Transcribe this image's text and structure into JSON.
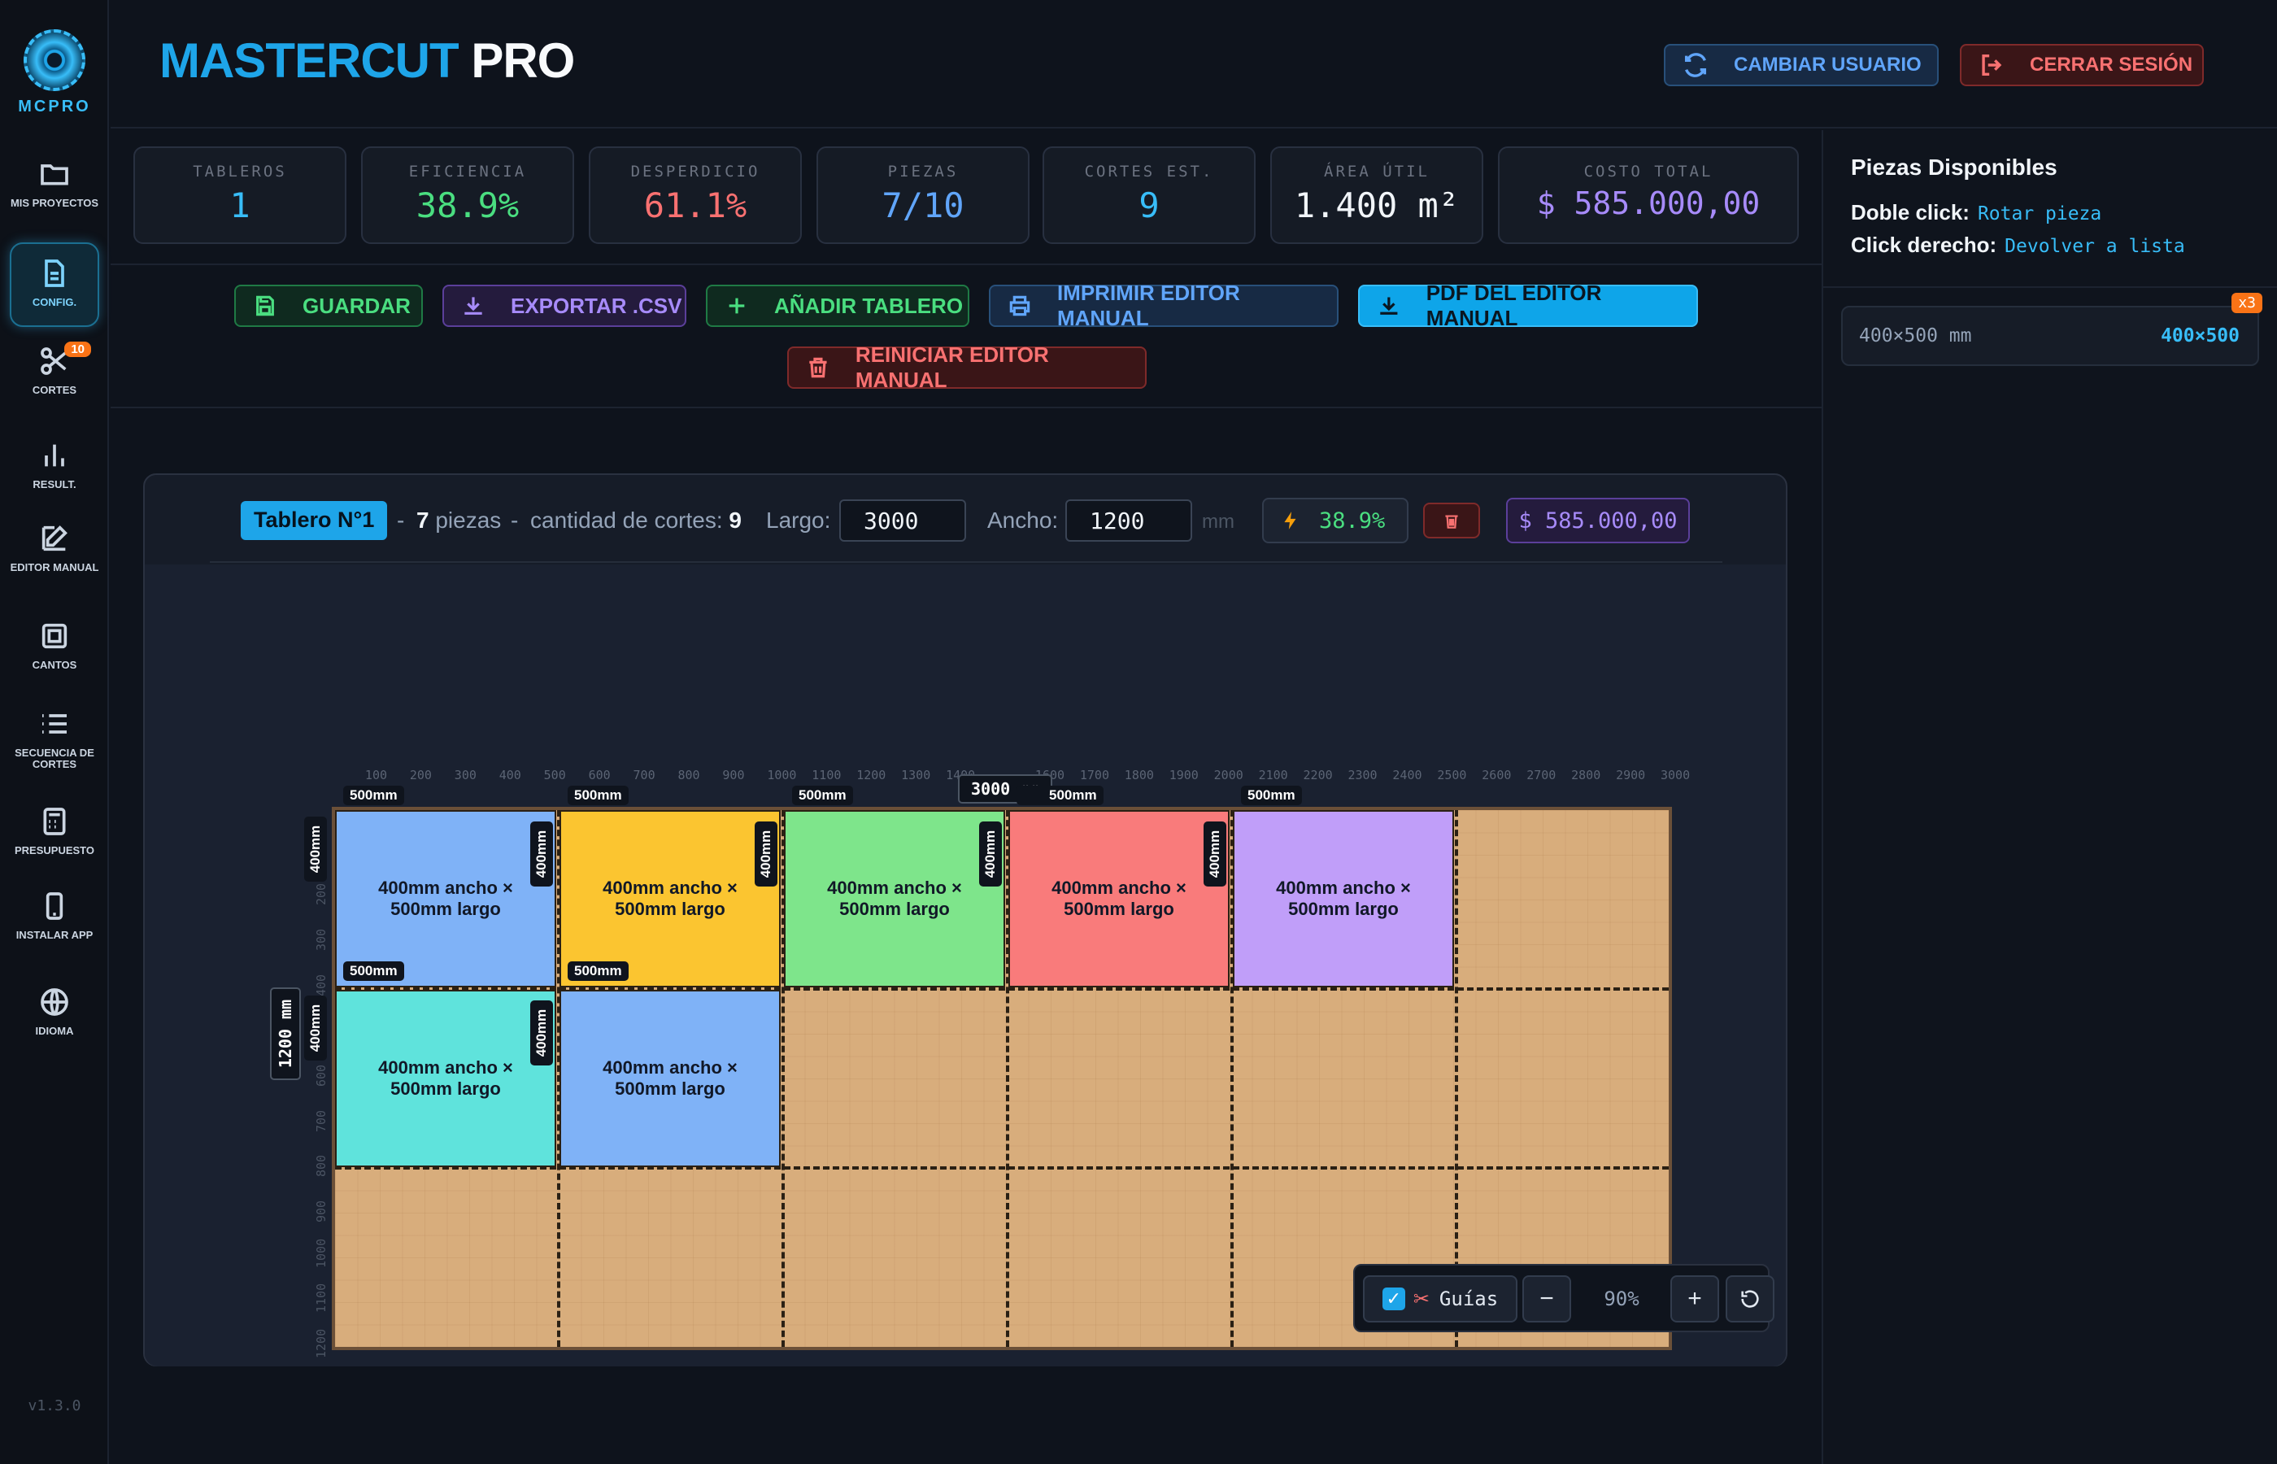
{
  "sidebar": {
    "logo_text": "MCPRO",
    "version": "v1.3.0",
    "items": [
      {
        "label": "MIS PROYECTOS",
        "icon": "folder-icon"
      },
      {
        "label": "CONFIG.",
        "icon": "document-icon"
      },
      {
        "label": "CORTES",
        "icon": "scissors-icon",
        "badge": "10"
      },
      {
        "label": "RESULT.",
        "icon": "bar-chart-icon"
      },
      {
        "label": "EDITOR MANUAL",
        "icon": "edit-icon"
      },
      {
        "label": "CANTOS",
        "icon": "square-icon"
      },
      {
        "label": "SECUENCIA DE CORTES",
        "icon": "list-icon"
      },
      {
        "label": "PRESUPUESTO",
        "icon": "calculator-icon"
      },
      {
        "label": "INSTALAR APP",
        "icon": "phone-icon"
      },
      {
        "label": "IDIOMA",
        "icon": "globe-icon"
      }
    ]
  },
  "header": {
    "brand_a": "MASTERCUT",
    "brand_b": "PRO",
    "switch_user": "CAMBIAR USUARIO",
    "logout": "CERRAR SESIÓN"
  },
  "stats": [
    {
      "title": "TABLEROS",
      "value": "1",
      "color": "#38bdf8"
    },
    {
      "title": "EFICIENCIA",
      "value": "38.9%",
      "color": "#4ade80"
    },
    {
      "title": "DESPERDICIO",
      "value": "61.1%",
      "color": "#f87171"
    },
    {
      "title": "PIEZAS",
      "value": "7/10",
      "color": "#60a5fa"
    },
    {
      "title": "CORTES EST.",
      "value": "9",
      "color": "#38bdf8"
    },
    {
      "title": "ÁREA ÚTIL",
      "value": "1.400 m²",
      "color": "#f1f5f9"
    },
    {
      "title": "COSTO TOTAL",
      "value": "$ 585.000,00",
      "color": "#a78bfa"
    }
  ],
  "toolbar": {
    "save": "GUARDAR",
    "export": "EXPORTAR .CSV",
    "add_board": "AÑADIR TABLERO",
    "print": "IMPRIMIR EDITOR MANUAL",
    "pdf": "PDF DEL EDITOR MANUAL",
    "reset": "REINICIAR EDITOR MANUAL"
  },
  "board_header": {
    "tag": "Tablero N°1",
    "sep1": "-",
    "pieces_count": "7",
    "pieces_word": "piezas",
    "sep2": "-",
    "cuts_label": "cantidad de cortes:",
    "cuts_count": "9",
    "largo_label": "Largo:",
    "largo_value": "3000",
    "ancho_label": "Ancho:",
    "ancho_value": "1200",
    "unit": "mm",
    "efficiency": "38.9%",
    "cost": "$ 585.000,00"
  },
  "board": {
    "length_label": "3000 mm",
    "width_label": "1200 mm",
    "x_ticks": [
      "100",
      "200",
      "300",
      "400",
      "500",
      "600",
      "700",
      "800",
      "900",
      "1000",
      "1100",
      "1200",
      "1300",
      "1400",
      "1600",
      "1700",
      "1800",
      "1900",
      "2000",
      "2100",
      "2200",
      "2300",
      "2400",
      "2500",
      "2600",
      "2700",
      "2800",
      "2900",
      "3000"
    ],
    "y_ticks": [
      "200",
      "300",
      "400",
      "500",
      "600",
      "700",
      "800",
      "900",
      "1000",
      "1100",
      "1200"
    ],
    "pieces": [
      {
        "label": "400mm ancho × 500mm largo",
        "color": "#7fb2f7",
        "row": 0,
        "col": 0
      },
      {
        "label": "400mm ancho × 500mm largo",
        "color": "#fbc530",
        "row": 0,
        "col": 1
      },
      {
        "label": "400mm ancho × 500mm largo",
        "color": "#7ee58b",
        "row": 0,
        "col": 2
      },
      {
        "label": "400mm ancho × 500mm largo",
        "color": "#f97b7b",
        "row": 0,
        "col": 3
      },
      {
        "label": "400mm ancho × 500mm largo",
        "color": "#c09ef9",
        "row": 0,
        "col": 4
      },
      {
        "label": "400mm ancho × 500mm largo",
        "color": "#5fe3dc",
        "row": 1,
        "col": 0
      },
      {
        "label": "400mm ancho × 500mm largo",
        "color": "#7fb2f7",
        "row": 1,
        "col": 1
      }
    ],
    "dim_w": "500mm",
    "dim_h": "400mm"
  },
  "zoom": {
    "guides": "Guías",
    "minus": "−",
    "level": "90%",
    "plus": "+"
  },
  "right_panel": {
    "title": "Piezas Disponibles",
    "dbl_label": "Doble click:",
    "dbl_hint": "Rotar pieza",
    "right_label": "Click derecho:",
    "right_hint": "Devolver a lista",
    "piece_name": "400×500 mm",
    "piece_dims": "400×500",
    "piece_qty": "x3"
  }
}
